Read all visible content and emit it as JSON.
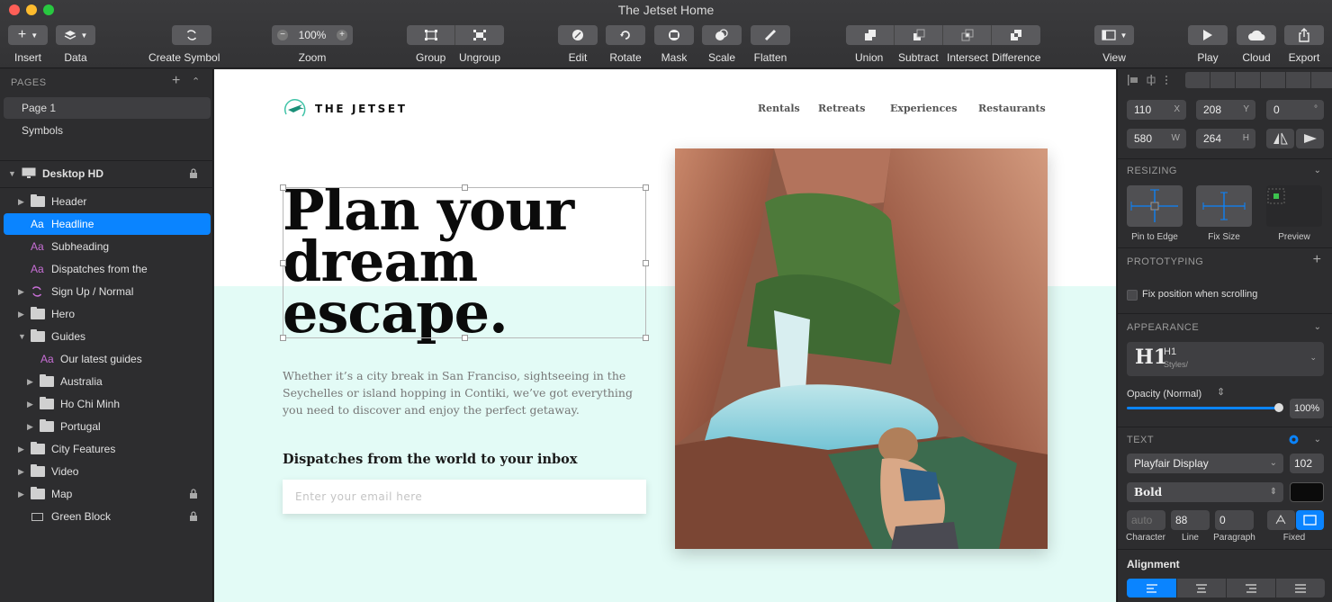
{
  "window": {
    "title": "The Jetset Home"
  },
  "toolbar": {
    "insert": "Insert",
    "data": "Data",
    "create_symbol": "Create Symbol",
    "zoom_label": "Zoom",
    "zoom_value": "100%",
    "group": "Group",
    "ungroup": "Ungroup",
    "edit": "Edit",
    "rotate": "Rotate",
    "mask": "Mask",
    "scale": "Scale",
    "flatten": "Flatten",
    "union": "Union",
    "subtract": "Subtract",
    "intersect": "Intersect",
    "difference": "Difference",
    "view": "View",
    "play": "Play",
    "cloud": "Cloud",
    "export": "Export",
    "plus": "+",
    "minus": "−"
  },
  "pages": {
    "header": "PAGES",
    "items": [
      "Page 1",
      "Symbols"
    ]
  },
  "layers": {
    "artboard": "Desktop HD",
    "items": [
      {
        "label": "Header"
      },
      {
        "label": "Headline"
      },
      {
        "label": "Subheading"
      },
      {
        "label": "Dispatches from the"
      },
      {
        "label": "Sign Up / Normal"
      },
      {
        "label": "Hero"
      },
      {
        "label": "Guides"
      },
      {
        "label": "Our latest guides"
      },
      {
        "label": "Australia"
      },
      {
        "label": "Ho Chi Minh"
      },
      {
        "label": "Portugal"
      },
      {
        "label": "City Features"
      },
      {
        "label": "Video"
      },
      {
        "label": "Map"
      },
      {
        "label": "Green Block"
      }
    ],
    "text_glyph": "Aa"
  },
  "site": {
    "logo": "THE JETSET",
    "nav": [
      "Rentals",
      "Retreats",
      "Experiences",
      "Restaurants"
    ],
    "headline": [
      "Plan your",
      "dream",
      "escape."
    ],
    "subheading": "Whether it’s a city break in San Franciso, sightseeing in the Seychelles or island hopping in Contiki, we’ve got everything you need to discover and enjoy the perfect getaway.",
    "dispatches": "Dispatches from the world to your inbox",
    "email_placeholder": "Enter your email here"
  },
  "inspector": {
    "x": "110",
    "x_label": "X",
    "y": "208",
    "y_label": "Y",
    "rotation": "0",
    "rotation_unit": "°",
    "w": "580",
    "w_label": "W",
    "h": "264",
    "h_label": "H",
    "resizing": "RESIZING",
    "pin_to_edge": "Pin to Edge",
    "fix_size": "Fix Size",
    "preview": "Preview",
    "prototyping": "PROTOTYPING",
    "fix_position": "Fix position when scrolling",
    "appearance": "APPEARANCE",
    "style_name": "H1",
    "style_path": "Styles/",
    "style_glyph": "H1",
    "opacity_label": "Opacity (Normal)",
    "opacity_value": "100%",
    "opacity_fraction": 1.0,
    "text": "TEXT",
    "font_family": "Playfair Display",
    "font_size": "102",
    "font_weight": "Bold",
    "character_value": "auto",
    "line_value": "88",
    "paragraph_value": "0",
    "character_label": "Character",
    "line_label": "Line",
    "paragraph_label": "Paragraph",
    "fixed_label": "Fixed",
    "alignment": "Alignment"
  },
  "colors": {
    "selection": "#0a84ff",
    "mint": "#e3fbf6",
    "text_layer": "#c86fd6",
    "symbol": "#c86fd6"
  }
}
